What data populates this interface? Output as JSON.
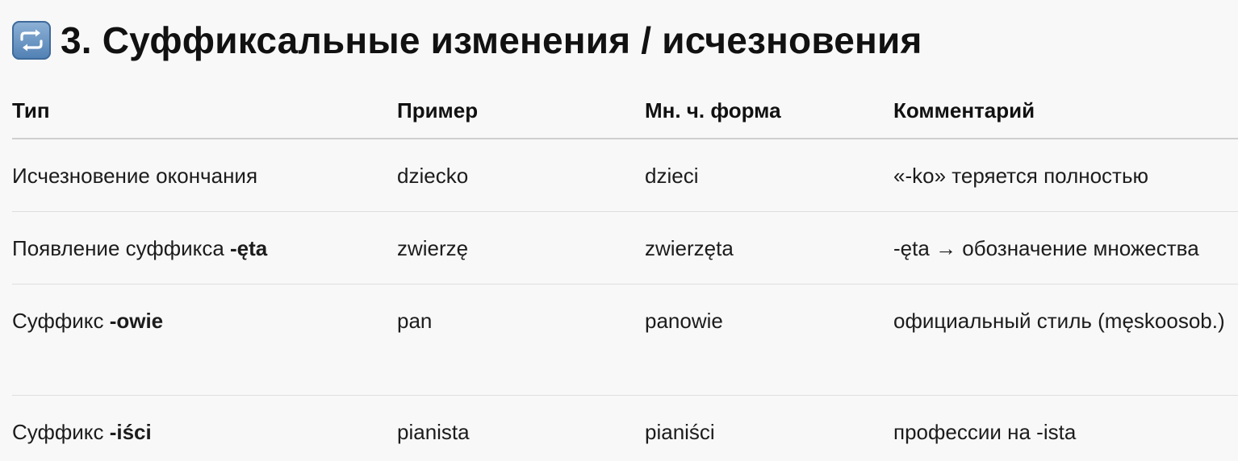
{
  "heading": {
    "icon": "repeat-arrows-icon",
    "text": "3. Суффиксальные изменения / исчезновения"
  },
  "table": {
    "headers": [
      "Тип",
      "Пример",
      "Мн. ч. форма",
      "Комментарий"
    ],
    "rows": [
      {
        "type_text": "Исчезновение окончания",
        "type_bold": "",
        "example": "dziecko",
        "plural": "dzieci",
        "comment": "«-ko» теряется полностью"
      },
      {
        "type_text": "Появление суффикса ",
        "type_bold": "-ęta",
        "example": "zwierzę",
        "plural": "zwierzęta",
        "comment": "-ęta → обозначение множества"
      },
      {
        "type_text": "Суффикс ",
        "type_bold": "-owie",
        "example": "pan",
        "plural": "panowie",
        "comment": "официальный стиль (męskoosob.)"
      },
      {
        "type_text": "Суффикс ",
        "type_bold": "-iści",
        "example": "pianista",
        "plural": "pianiści",
        "comment": "профессии на -ista"
      }
    ]
  }
}
